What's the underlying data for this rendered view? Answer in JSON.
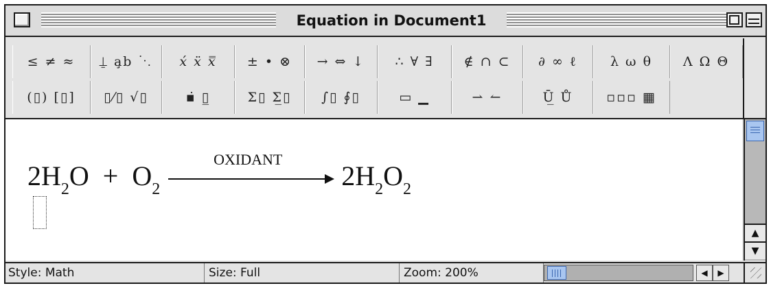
{
  "window": {
    "title": "Equation in Document1"
  },
  "palette": {
    "row1": [
      {
        "label": "≤ ≠ ≈",
        "name": "relational-symbols-palette"
      },
      {
        "label": "⍊ a̧b ⋱",
        "name": "spaces-ellipses-palette"
      },
      {
        "label": "𝑥́ 𝑥̈ 𝑥̿",
        "name": "embellishments-palette"
      },
      {
        "label": "± • ⊗",
        "name": "operator-symbols-palette"
      },
      {
        "label": "→ ⇔ ↓",
        "name": "arrow-symbols-palette"
      },
      {
        "label": "∴ ∀ ∃",
        "name": "logical-symbols-palette"
      },
      {
        "label": "∉ ∩ ⊂",
        "name": "set-theory-symbols-palette"
      },
      {
        "label": "∂ ∞ ℓ",
        "name": "miscellaneous-symbols-palette"
      },
      {
        "label": "λ ω θ",
        "name": "greek-lowercase-palette"
      },
      {
        "label": "Λ Ω Θ",
        "name": "greek-uppercase-palette"
      }
    ],
    "row2": [
      {
        "label": "(▯) [▯]",
        "name": "fence-templates-palette"
      },
      {
        "label": "▯⁄▯ √▯",
        "name": "fraction-radical-templates-palette"
      },
      {
        "label": "▪̇ ▯̲",
        "name": "subscript-superscript-templates-palette"
      },
      {
        "label": "Σ▯ Σ̲▯",
        "name": "summation-templates-palette"
      },
      {
        "label": "∫▯ ∮▯",
        "name": "integral-templates-palette"
      },
      {
        "label": "▭ ▁",
        "name": "underbar-overbar-templates-palette"
      },
      {
        "label": "⇀ ↼",
        "name": "labeled-arrow-templates-palette"
      },
      {
        "label": "Ū̲ Ů",
        "name": "products-set-theory-templates-palette"
      },
      {
        "label": "▫▫▫ ▦",
        "name": "matrix-templates-palette"
      }
    ]
  },
  "equation": {
    "reactant1_coef": "2H",
    "reactant1_sub": "2",
    "reactant1_tail": "O",
    "plus": "+",
    "reactant2_base": "O",
    "reactant2_sub": "2",
    "arrow_label": "OXIDANT",
    "product_coef": "2H",
    "product_sub1": "2",
    "product_mid": "O",
    "product_sub2": "2"
  },
  "status": {
    "style": "Style: Math",
    "size": "Size: Full",
    "zoom": "Zoom: 200%"
  },
  "scroll_arrows": {
    "up": "▲",
    "down": "▼",
    "left": "◀",
    "right": "▶"
  }
}
